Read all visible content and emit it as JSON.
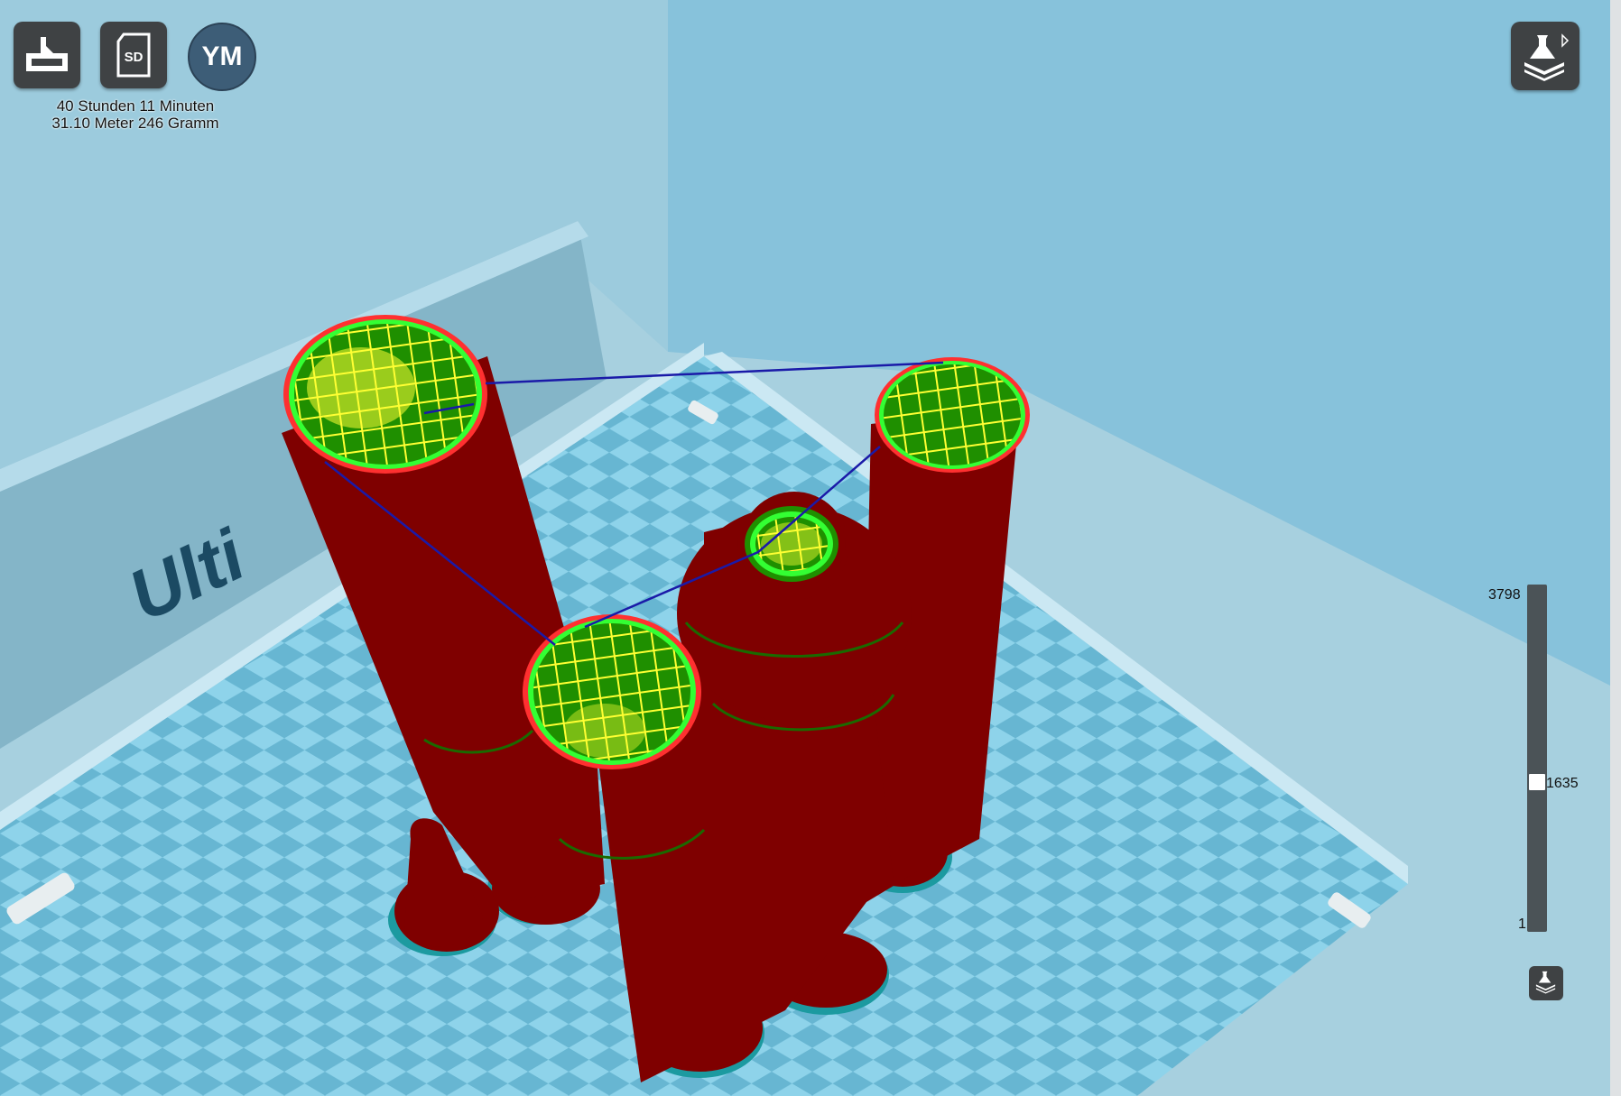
{
  "toolbar": {
    "print_icon": "printer-icon",
    "sd_icon": "sd-card-icon",
    "sd_label": "SD",
    "machine_initials": "YM"
  },
  "print_info": {
    "time": "40 Stunden 11 Minuten",
    "material": "31.10 Meter 246 Gramm"
  },
  "view_mode": {
    "icon": "layer-view-icon"
  },
  "layer_slider": {
    "max": "3798",
    "current": "1635",
    "min": "1",
    "current_fraction": 0.43
  },
  "scene": {
    "brand_text": "Ulti",
    "colors": {
      "background": "#8ec7dd",
      "model_wall": "#7f0000",
      "infill": "#ffff33",
      "skin": "#1f8f00",
      "outer_wall": "#33ff33",
      "travel": "#1a1aa8",
      "plate_check_a": "#8ed3ea",
      "plate_check_b": "#68b7d3"
    }
  }
}
